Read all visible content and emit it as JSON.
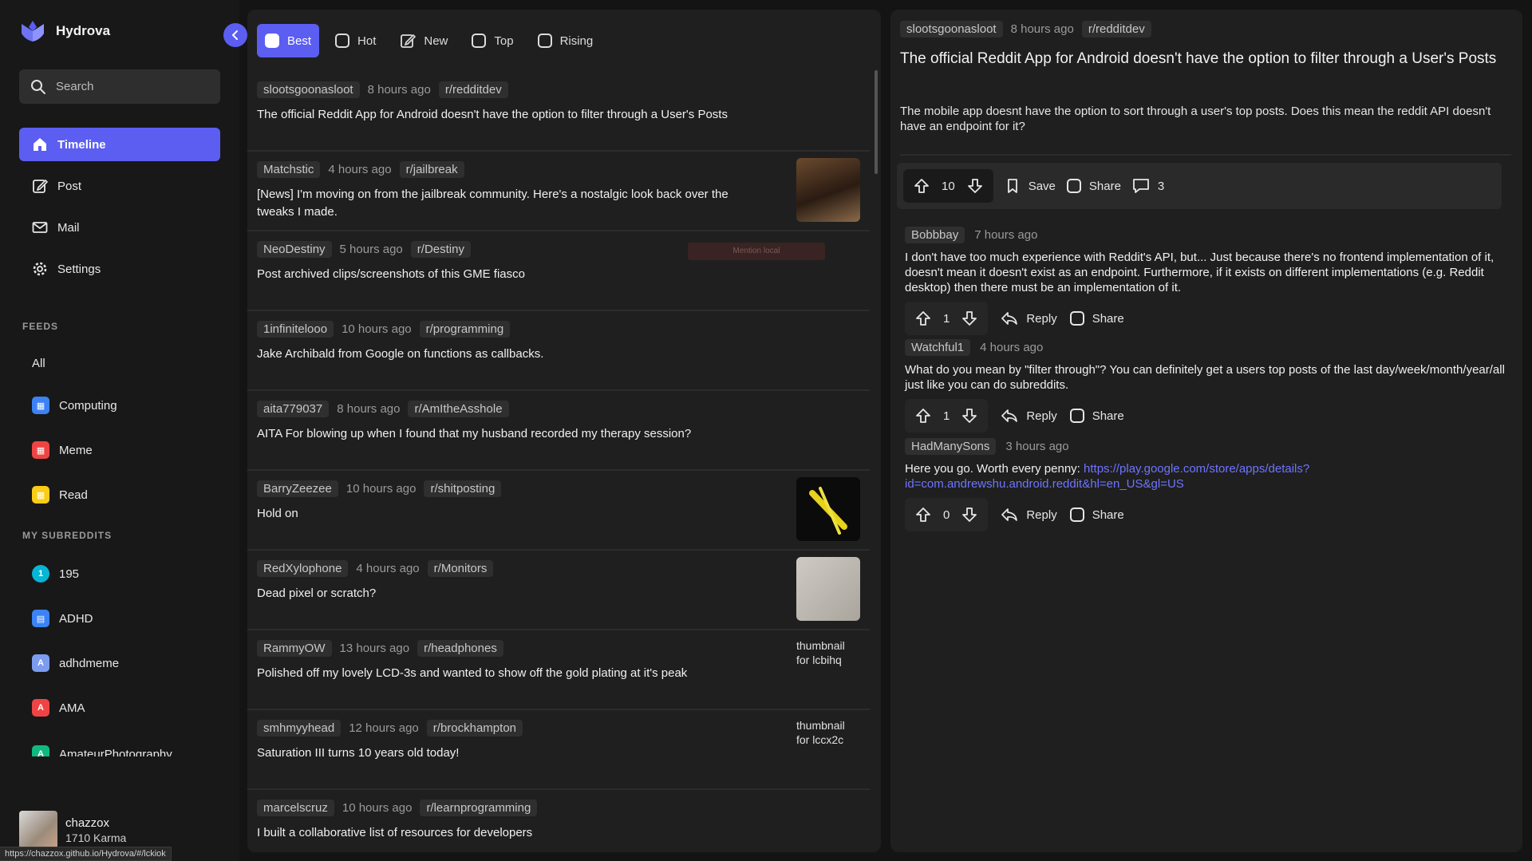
{
  "app": {
    "name": "Hydrova"
  },
  "sidebar": {
    "search_placeholder": "Search",
    "nav": [
      {
        "label": "Timeline",
        "icon": "home-icon",
        "active": true
      },
      {
        "label": "Post",
        "icon": "edit-icon"
      },
      {
        "label": "Mail",
        "icon": "mail-icon"
      },
      {
        "label": "Settings",
        "icon": "gear-icon"
      }
    ],
    "feeds_title": "FEEDS",
    "feeds": [
      {
        "label": "All"
      },
      {
        "label": "Computing",
        "icon": "computing-icon",
        "color": "#3b82f6"
      },
      {
        "label": "Meme",
        "icon": "meme-icon",
        "color": "#ef4444"
      },
      {
        "label": "Read",
        "icon": "read-icon",
        "color": "#facc15"
      }
    ],
    "subreddits_title": "MY SUBREDDITS",
    "subreddits": [
      {
        "label": "195",
        "badge": "1",
        "color": "#06b6d4"
      },
      {
        "label": "ADHD",
        "badge": "",
        "color": "#3b82f6"
      },
      {
        "label": "adhdmeme",
        "badge": "A",
        "color": "#7c9cf0"
      },
      {
        "label": "AMA",
        "badge": "A",
        "color": "#ef4444"
      },
      {
        "label": "AmateurPhotography",
        "badge": "A",
        "color": "#10b981"
      }
    ],
    "user": {
      "name": "chazzox",
      "karma": "1710 Karma"
    },
    "status_url": "https://chazzox.github.io/Hydrova/#/lckiok"
  },
  "feed": {
    "tabs": [
      {
        "label": "Best",
        "active": true
      },
      {
        "label": "Hot"
      },
      {
        "label": "New"
      },
      {
        "label": "Top"
      },
      {
        "label": "Rising"
      }
    ],
    "faint_badge": "Mention local",
    "posts": [
      {
        "author": "slootsgoonasloot",
        "time": "8 hours ago",
        "sub": "r/redditdev",
        "title": "The official Reddit App for Android doesn't have the option to filter through a User's Posts",
        "thumb": "none"
      },
      {
        "author": "Matchstic",
        "time": "4 hours ago",
        "sub": "r/jailbreak",
        "title": "[News] I'm moving on from the jailbreak community. Here's a nostalgic look back over the tweaks I made.",
        "thumb": "image"
      },
      {
        "author": "NeoDestiny",
        "time": "5 hours ago",
        "sub": "r/Destiny",
        "title": "Post archived clips/screenshots of this GME fiasco",
        "thumb": "none"
      },
      {
        "author": "1infinitelooo",
        "time": "10 hours ago",
        "sub": "r/programming",
        "title": "Jake Archibald from Google on functions as callbacks.",
        "thumb": "none"
      },
      {
        "author": "aita779037",
        "time": "8 hours ago",
        "sub": "r/AmItheAsshole",
        "title": "AITA For blowing up when I found that my husband recorded my therapy session?",
        "thumb": "none"
      },
      {
        "author": "BarryZeezee",
        "time": "10 hours ago",
        "sub": "r/shitposting",
        "title": "Hold on",
        "thumb": "image"
      },
      {
        "author": "RedXylophone",
        "time": "4 hours ago",
        "sub": "r/Monitors",
        "title": "Dead pixel or scratch?",
        "thumb": "image"
      },
      {
        "author": "RammyOW",
        "time": "13 hours ago",
        "sub": "r/headphones",
        "title": "Polished off my lovely LCD-3s and wanted to show off the gold plating at it's peak",
        "thumb_alt": "thumbnail for lcbihq"
      },
      {
        "author": "smhmyyhead",
        "time": "12 hours ago",
        "sub": "r/brockhampton",
        "title": "Saturation III turns 10 years old today!",
        "thumb_alt": "thumbnail for lccx2c"
      },
      {
        "author": "marcelscruz",
        "time": "10 hours ago",
        "sub": "r/learnprogramming",
        "title": "I built a collaborative list of resources for developers",
        "thumb": "none"
      }
    ]
  },
  "detail": {
    "author": "slootsgoonasloot",
    "time": "8 hours ago",
    "sub": "r/redditdev",
    "title": "The official Reddit App for Android doesn't have the option to filter through a User's Posts",
    "body": "The mobile app doesnt have the option to sort through a user's top posts. Does this mean the reddit API doesn't have an endpoint for it?",
    "score": "10",
    "save_label": "Save",
    "share_label": "Share",
    "comment_count": "3",
    "comments": [
      {
        "author": "Bobbbay",
        "time": "7 hours ago",
        "body": "I don't have too much experience with Reddit's API, but... Just because there's no frontend implementation of it, doesn't mean it doesn't exist as an endpoint. Furthermore, if it exists on different implementations (e.g. Reddit desktop) then there must be an implementation of it.",
        "score": "1",
        "reply": "Reply",
        "share": "Share"
      },
      {
        "author": "Watchful1",
        "time": "4 hours ago",
        "body": "What do you mean by \"filter through\"? You can definitely get a users top posts of the last day/week/month/year/all just like you can do subreddits.",
        "score": "1",
        "reply": "Reply",
        "share": "Share"
      },
      {
        "author": "HadManySons",
        "time": "3 hours ago",
        "body": "Here you go. Worth every penny: ",
        "link": "https://play.google.com/store/apps/details?id=com.andrewshu.android.reddit&hl=en_US&gl=US",
        "score": "0",
        "reply": "Reply",
        "share": "Share"
      }
    ]
  }
}
